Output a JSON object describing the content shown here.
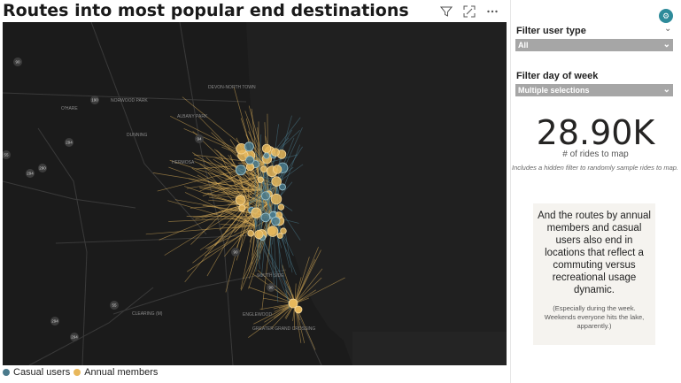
{
  "page_title": "Routes into most popular end destinations",
  "icons": {
    "filter": "filter-icon",
    "focus": "focus-mode-icon",
    "more": "more-options-icon"
  },
  "map": {
    "labels": [
      "DEVON-NORTH TOWN",
      "NORWOOD PARK",
      "O'HARE",
      "ALBANY PARK",
      "DUNNING",
      "HERMOSA",
      "SOUTH SIDE",
      "CLEARING (M)",
      "ENGLEWOOD",
      "GREATER GRAND CROSSING"
    ],
    "highway_shields": [
      "90",
      "190",
      "294",
      "294",
      "290",
      "94",
      "90",
      "90",
      "55",
      "294",
      "294",
      "55"
    ]
  },
  "legend": [
    {
      "label": "Casual users",
      "color": "#4a7a8c"
    },
    {
      "label": "Annual members",
      "color": "#e8b85c"
    }
  ],
  "filters": {
    "user_type": {
      "label": "Filter user type",
      "value": "All"
    },
    "day_of_week": {
      "label": "Filter day of week",
      "value": "Multiple selections"
    }
  },
  "kpi": {
    "value": "28.90K",
    "label": "# of rides to map",
    "note": "Includes a hidden filter to randomly sample rides to map."
  },
  "card": {
    "main": "And the routes by annual members and casual users also end in locations that reflect a commuting versus recreational usage dynamic.",
    "sub": "(Especially during the week. Weekends everyone hits the lake, apparently.)"
  },
  "colors": {
    "casual": "#4a7a8c",
    "annual": "#e8b85c",
    "map_bg": "#1b1b1b",
    "lake": "#202020",
    "card_bg": "#f5f3ef"
  }
}
